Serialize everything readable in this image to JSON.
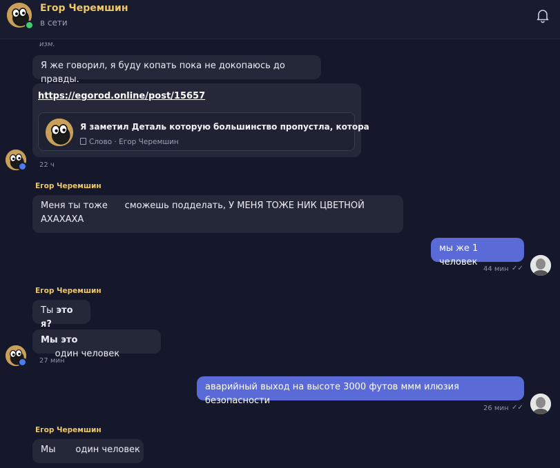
{
  "header": {
    "name": "Егор Черемшин",
    "status": "в сети"
  },
  "messages": {
    "edited_label": "изм.",
    "m1": {
      "text": "Я же говорил, я буду копать пока не докопаюсь до правды."
    },
    "m2": {
      "link": "https://egorod.online/post/15657",
      "preview_title": "Я заметил Деталь которую большинство пропустла, котора",
      "preview_meta": "Слово · Егор Черемшин"
    },
    "time1": "22 ч",
    "sender": "Егор Черемшин",
    "m3": {
      "line1": "Меня ты тоже      сможешь подделать, У МЕНЯ ТОЖЕ НИК ЦВЕТНОЙ",
      "line2": "АХАХАХА"
    },
    "own1": {
      "text": "мы же 1 человек",
      "time": "44 мин",
      "checks": "✓✓"
    },
    "m4": {
      "prefix": "Ты ",
      "bold": "это я?"
    },
    "m5": {
      "bold": "Мы это",
      "rest": "     один человек"
    },
    "time2": "27 мин",
    "own2": {
      "text": "аварийный выход на высоте 3000 футов ммм илюзия безопасности",
      "time": "26 мин",
      "checks": "✓✓"
    },
    "m6": {
      "text": "Мы       один человек"
    }
  },
  "colors": {
    "background": "#15182a",
    "bubble": "#242838",
    "own_bubble": "#5a6ad6",
    "name_accent": "#f0c865"
  },
  "icons": {
    "bell": "bell-icon",
    "avatar": "cartoon-avatar",
    "verified": "verified-badge-icon",
    "post": "post-icon",
    "read": "double-check-icon"
  }
}
